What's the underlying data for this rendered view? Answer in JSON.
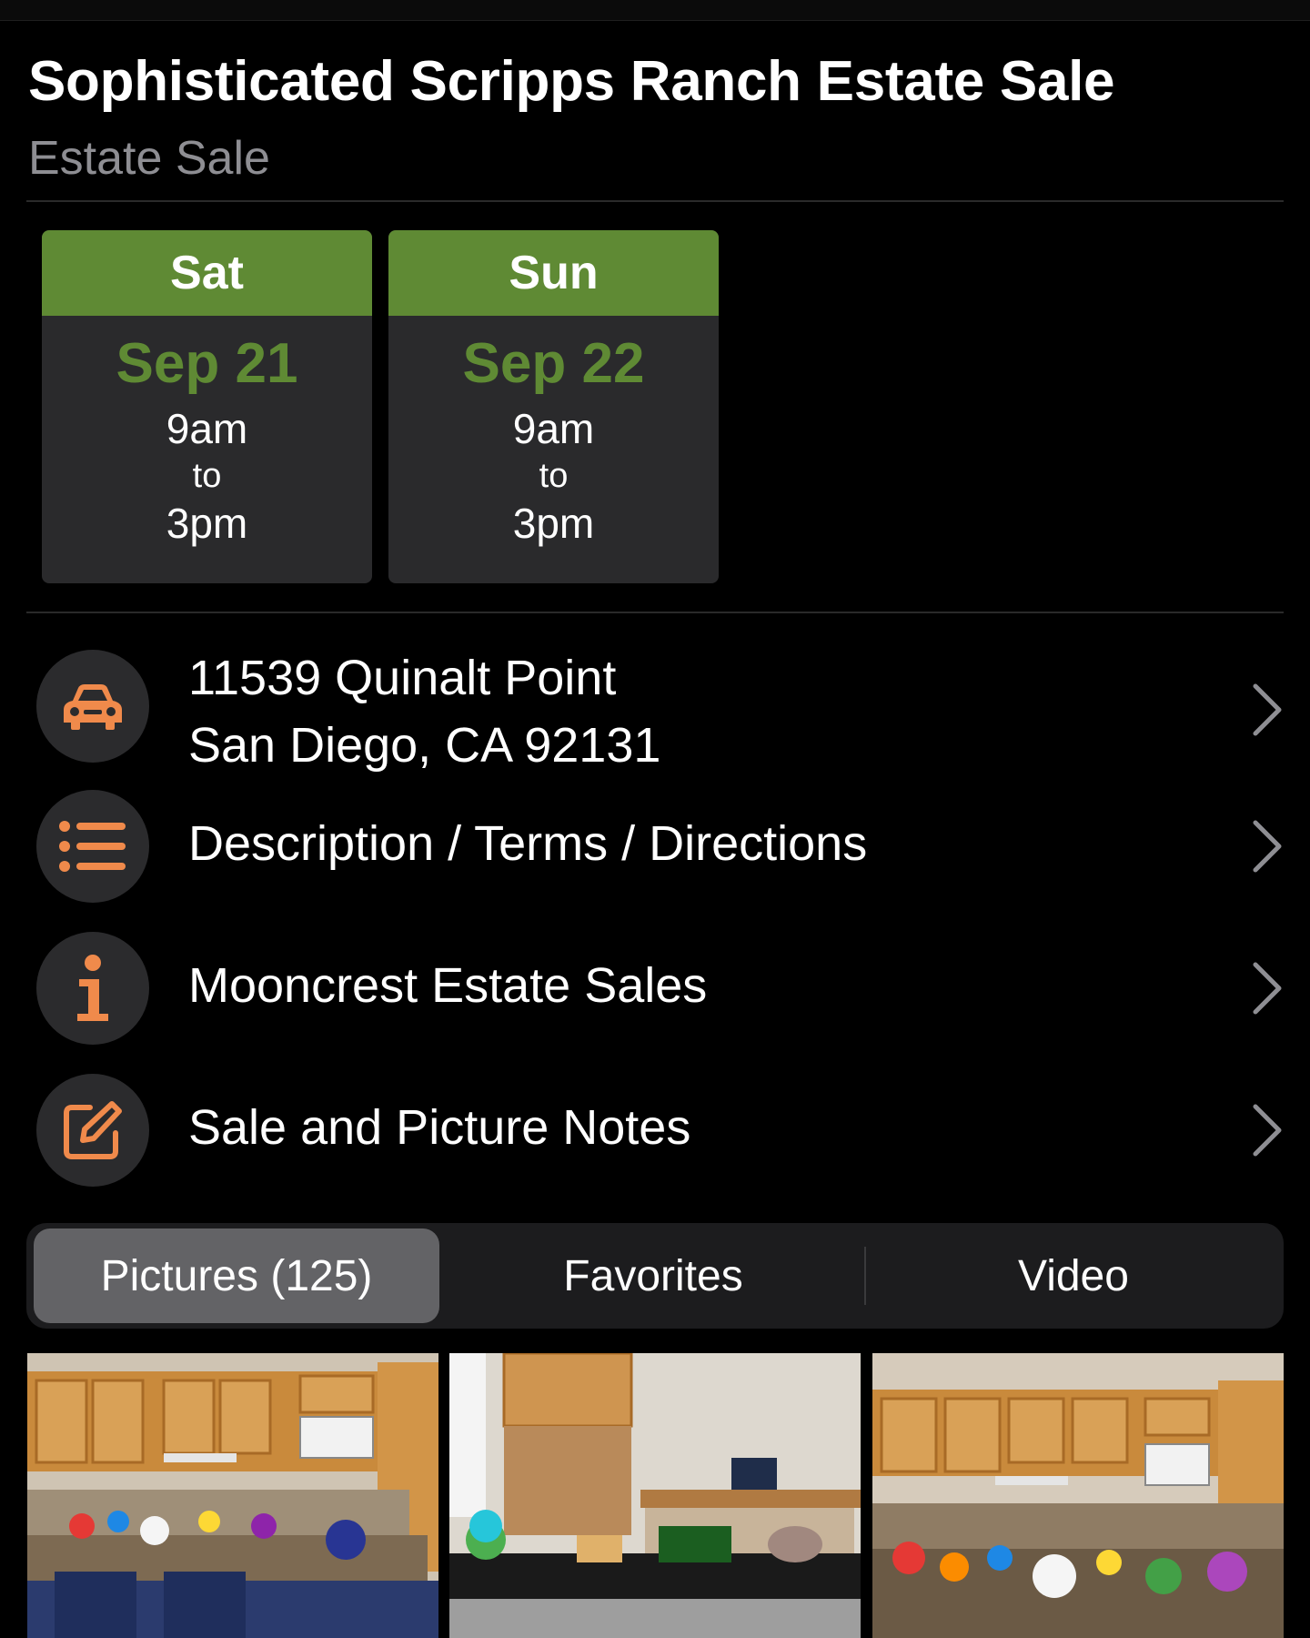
{
  "sale": {
    "title": "Sophisticated Scripps Ranch Estate Sale",
    "type": "Estate Sale"
  },
  "days": [
    {
      "day": "Sat",
      "date": "Sep 21",
      "start": "9am",
      "to": "to",
      "end": "3pm"
    },
    {
      "day": "Sun",
      "date": "Sep 22",
      "start": "9am",
      "to": "to",
      "end": "3pm"
    }
  ],
  "rows": {
    "address": {
      "line1": "11539 Quinalt Point",
      "line2": "San Diego, CA 92131",
      "icon": "car-icon"
    },
    "description": {
      "label": "Description / Terms / Directions",
      "icon": "list-icon"
    },
    "company": {
      "label": "Mooncrest Estate Sales",
      "icon": "info-icon"
    },
    "notes": {
      "label": "Sale and Picture Notes",
      "icon": "edit-icon"
    }
  },
  "tabs": [
    {
      "label": "Pictures (125)",
      "selected": true
    },
    {
      "label": "Favorites",
      "selected": false
    },
    {
      "label": "Video",
      "selected": false
    }
  ],
  "colors": {
    "accent": "#f08a4b",
    "day_header_green": "#5f8a34",
    "card_bg": "#2a2a2c",
    "background": "#000000"
  }
}
